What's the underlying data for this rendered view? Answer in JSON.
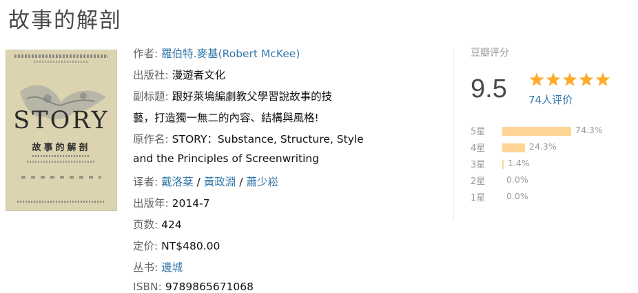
{
  "book": {
    "title": "故事的解剖",
    "cover": {
      "main_text": "STORY",
      "zh_text": "故事的解剖",
      "icon": "book-cover-image"
    }
  },
  "info": {
    "author_label": "作者:",
    "author_value": "羅伯特.麥基(Robert McKee)",
    "publisher_label": "出版社:",
    "publisher_value": "漫遊者文化",
    "subtitle_label": "副标题:",
    "subtitle_value_1": "跟好萊塢編劇教父學習說故事的技",
    "subtitle_value_2": "藝，打造獨一無二的內容、結構與風格!",
    "original_label": "原作名:",
    "original_value_1": "STORY：Substance, Structure, Style",
    "original_value_2": "and the Principles of Screenwriting",
    "translator_label": "译者:",
    "translators": [
      "戴洛棻",
      "黃政淵",
      "蕭少崧"
    ],
    "translator_sep": " / ",
    "year_label": "出版年:",
    "year_value": "2014-7",
    "pages_label": "页数:",
    "pages_value": "424",
    "price_label": "定价:",
    "price_value": "NT$480.00",
    "series_label": "丛书:",
    "series_value": "邊城",
    "isbn_label": "ISBN:",
    "isbn_value": "9789865671068"
  },
  "rating": {
    "label": "豆瓣评分",
    "score": "9.5",
    "stars": 5,
    "count_text": "74人评价",
    "colors": {
      "star": "#ffac2d",
      "bar": "#ffd596",
      "link": "#3377aa"
    },
    "distribution": [
      {
        "label": "5星",
        "pct_text": "74.3%",
        "pct": 74.3
      },
      {
        "label": "4星",
        "pct_text": "24.3%",
        "pct": 24.3
      },
      {
        "label": "3星",
        "pct_text": "1.4%",
        "pct": 1.4
      },
      {
        "label": "2星",
        "pct_text": "0.0%",
        "pct": 0.0
      },
      {
        "label": "1星",
        "pct_text": "0.0%",
        "pct": 0.0
      }
    ]
  }
}
